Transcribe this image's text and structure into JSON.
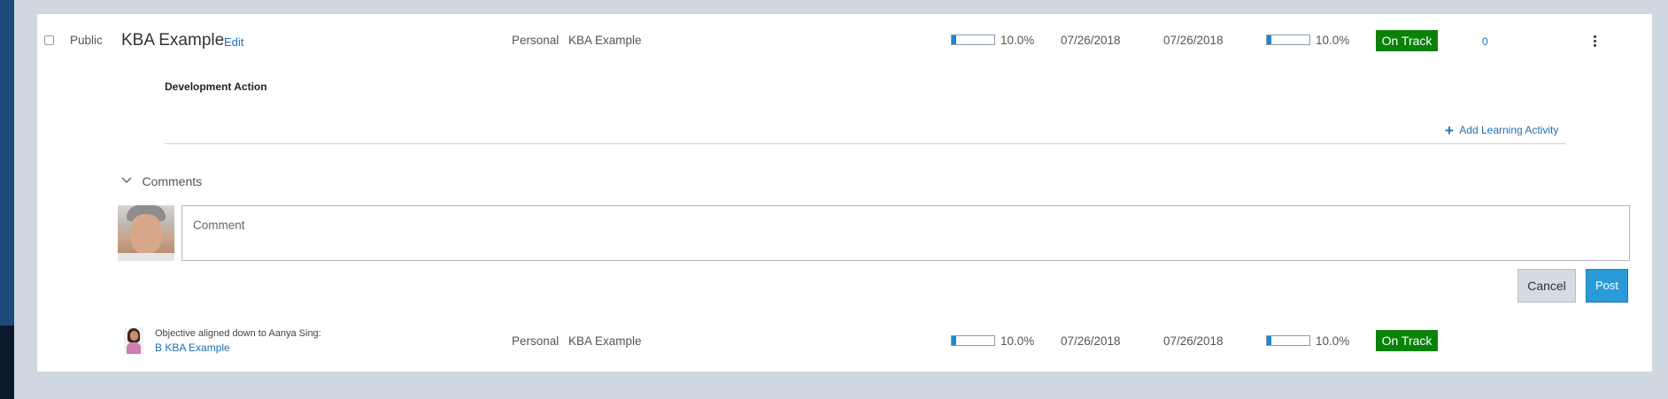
{
  "row1": {
    "visibility": "Public",
    "title": "KBA Example",
    "edit_label": "Edit",
    "category": "Personal",
    "name": "KBA Example",
    "progress1": {
      "label": "10.0%",
      "fraction": 0.1
    },
    "start_date": "07/26/2018",
    "due_date": "07/26/2018",
    "progress2": {
      "label": "10.0%",
      "fraction": 0.1
    },
    "status": "On Track",
    "status_color": "#0a820a",
    "count": "0",
    "menu_icon": "vertical-ellipsis-icon"
  },
  "development": {
    "heading": "Development Action",
    "add_icon": "plus-icon",
    "add_label": "Add Learning Activity"
  },
  "comments": {
    "toggle_icon": "chevron-down-icon",
    "label": "Comments",
    "placeholder": "Comment",
    "cancel_label": "Cancel",
    "post_label": "Post",
    "post_color": "#2a9bd8"
  },
  "row2": {
    "note": "Objective aligned down to Aanya Sing:",
    "link": "B KBA Example",
    "category": "Personal",
    "name": "KBA Example",
    "progress1": {
      "label": "10.0%",
      "fraction": 0.1
    },
    "start_date": "07/26/2018",
    "due_date": "07/26/2018",
    "progress2": {
      "label": "10.0%",
      "fraction": 0.1
    },
    "status": "On Track",
    "status_color": "#0a820a"
  }
}
